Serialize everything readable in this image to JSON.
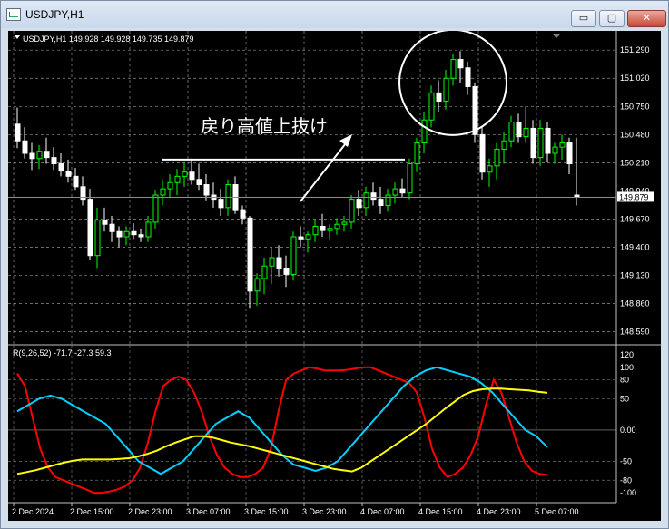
{
  "window": {
    "title": "USDJPY,H1",
    "buttons": {
      "minimize": "▭",
      "maximize": "▢",
      "close": "✕"
    }
  },
  "chart_data": [
    {
      "type": "candlestick",
      "title": "USDJPY,H1  149.928 149.928 149.735 149.879",
      "ylim": [
        148.5,
        151.37
      ],
      "y_ticks": [
        "151.290",
        "151.020",
        "150.750",
        "150.480",
        "150.210",
        "149.940",
        "149.670",
        "149.400",
        "149.130",
        "148.860",
        "148.590"
      ],
      "current_price": "149.879",
      "grid": true,
      "colors": {
        "background": "#000000",
        "bull": "#00ff00",
        "bear": "#ffffff",
        "grid": "#c0c0c0"
      },
      "candles": [
        [
          150.58,
          150.74,
          150.35,
          150.42
        ],
        [
          150.42,
          150.55,
          150.25,
          150.3
        ],
        [
          150.3,
          150.4,
          150.14,
          150.25
        ],
        [
          150.25,
          150.38,
          150.15,
          150.32
        ],
        [
          150.32,
          150.45,
          150.2,
          150.26
        ],
        [
          150.26,
          150.36,
          150.14,
          150.2
        ],
        [
          150.2,
          150.3,
          150.08,
          150.13
        ],
        [
          150.13,
          150.24,
          150.02,
          150.08
        ],
        [
          150.08,
          150.16,
          149.95,
          149.98
        ],
        [
          149.98,
          150.08,
          149.8,
          149.86
        ],
        [
          149.86,
          149.96,
          149.28,
          149.32
        ],
        [
          149.32,
          149.78,
          149.2,
          149.66
        ],
        [
          149.66,
          149.78,
          149.55,
          149.62
        ],
        [
          149.62,
          149.7,
          149.45,
          149.55
        ],
        [
          149.55,
          149.6,
          149.4,
          149.5
        ],
        [
          149.5,
          149.6,
          149.42,
          149.55
        ],
        [
          149.55,
          149.63,
          149.48,
          149.52
        ],
        [
          149.52,
          149.58,
          149.45,
          149.5
        ],
        [
          149.5,
          149.7,
          149.45,
          149.64
        ],
        [
          149.64,
          149.95,
          149.58,
          149.9
        ],
        [
          149.9,
          150.05,
          149.8,
          149.96
        ],
        [
          149.96,
          150.1,
          149.88,
          150.02
        ],
        [
          150.02,
          150.15,
          149.9,
          150.08
        ],
        [
          150.08,
          150.22,
          149.98,
          150.12
        ],
        [
          150.12,
          150.25,
          150.0,
          150.05
        ],
        [
          150.05,
          150.2,
          149.95,
          150.0
        ],
        [
          150.0,
          150.1,
          149.85,
          149.9
        ],
        [
          149.9,
          150.02,
          149.78,
          149.86
        ],
        [
          149.86,
          149.96,
          149.7,
          149.78
        ],
        [
          149.78,
          150.05,
          149.7,
          150.0
        ],
        [
          150.0,
          150.08,
          149.72,
          149.76
        ],
        [
          149.76,
          149.8,
          149.62,
          149.68
        ],
        [
          149.68,
          149.7,
          148.82,
          148.98
        ],
        [
          148.98,
          149.15,
          148.84,
          149.1
        ],
        [
          149.1,
          149.3,
          148.95,
          149.22
        ],
        [
          149.22,
          149.4,
          149.05,
          149.3
        ],
        [
          149.3,
          149.42,
          149.12,
          149.2
        ],
        [
          149.2,
          149.32,
          149.02,
          149.14
        ],
        [
          149.14,
          149.55,
          149.08,
          149.5
        ],
        [
          149.5,
          149.6,
          149.4,
          149.48
        ],
        [
          149.48,
          149.55,
          149.35,
          149.52
        ],
        [
          149.52,
          149.66,
          149.45,
          149.6
        ],
        [
          149.6,
          149.72,
          149.5,
          149.56
        ],
        [
          149.56,
          149.62,
          149.48,
          149.58
        ],
        [
          149.58,
          149.68,
          149.52,
          149.62
        ],
        [
          149.62,
          149.7,
          149.55,
          149.64
        ],
        [
          149.64,
          149.9,
          149.58,
          149.86
        ],
        [
          149.86,
          149.95,
          149.7,
          149.78
        ],
        [
          149.78,
          149.98,
          149.7,
          149.92
        ],
        [
          149.92,
          150.02,
          149.8,
          149.86
        ],
        [
          149.86,
          149.98,
          149.72,
          149.8
        ],
        [
          149.8,
          149.96,
          149.74,
          149.9
        ],
        [
          149.9,
          150.02,
          149.82,
          149.96
        ],
        [
          149.96,
          150.06,
          149.88,
          149.92
        ],
        [
          149.92,
          150.25,
          149.86,
          150.2
        ],
        [
          150.2,
          150.45,
          150.12,
          150.4
        ],
        [
          150.4,
          150.7,
          150.3,
          150.62
        ],
        [
          150.62,
          150.95,
          150.55,
          150.88
        ],
        [
          150.88,
          151.0,
          150.7,
          150.8
        ],
        [
          150.8,
          151.1,
          150.72,
          151.02
        ],
        [
          151.02,
          151.25,
          150.95,
          151.2
        ],
        [
          151.2,
          151.28,
          150.98,
          151.12
        ],
        [
          151.12,
          151.18,
          150.86,
          150.94
        ],
        [
          150.94,
          150.98,
          150.4,
          150.48
        ],
        [
          150.48,
          150.55,
          150.05,
          150.12
        ],
        [
          150.12,
          150.25,
          149.98,
          150.18
        ],
        [
          150.18,
          150.4,
          150.05,
          150.34
        ],
        [
          150.34,
          150.5,
          150.2,
          150.42
        ],
        [
          150.42,
          150.66,
          150.36,
          150.6
        ],
        [
          150.6,
          150.68,
          150.4,
          150.46
        ],
        [
          150.46,
          150.75,
          150.4,
          150.54
        ],
        [
          150.54,
          150.62,
          150.2,
          150.26
        ],
        [
          150.26,
          150.62,
          150.18,
          150.54
        ],
        [
          150.54,
          150.6,
          150.22,
          150.3
        ],
        [
          150.3,
          150.4,
          150.2,
          150.36
        ],
        [
          150.36,
          150.48,
          150.24,
          150.4
        ],
        [
          150.4,
          150.45,
          150.1,
          150.2
        ],
        [
          149.9,
          150.45,
          149.8,
          149.88
        ]
      ],
      "annotation": {
        "text": "戻り高値上抜け",
        "level": 150.24,
        "circle_center": {
          "index": 60,
          "price": 150.98
        }
      }
    },
    {
      "type": "line",
      "title": "R(9,26,52) -71.7 -27.3 59.3",
      "ylim": [
        -110,
        130
      ],
      "y_ticks": [
        "120",
        "100",
        "80",
        "50",
        "0.00",
        "-50",
        "-80",
        "-100"
      ],
      "x_tick_labels": [
        "2 Dec 2024",
        "2 Dec 15:00",
        "2 Dec 23:00",
        "3 Dec 07:00",
        "3 Dec 15:00",
        "3 Dec 23:00",
        "4 Dec 07:00",
        "4 Dec 15:00",
        "4 Dec 23:00",
        "5 Dec 07:00"
      ],
      "x_tick_candle_index": [
        0,
        8,
        16,
        24,
        32,
        40,
        48,
        56,
        64,
        72
      ],
      "reference_line": 0,
      "series": [
        {
          "color": "#ff0000",
          "values": [
            90,
            70,
            20,
            -30,
            -60,
            -75,
            -80,
            -85,
            -90,
            -95,
            -100,
            -100,
            -98,
            -95,
            -90,
            -80,
            -60,
            -20,
            30,
            70,
            80,
            85,
            80,
            60,
            30,
            -10,
            -40,
            -60,
            -70,
            -75,
            -75,
            -70,
            -60,
            -30,
            30,
            80,
            90,
            95,
            100,
            98,
            95,
            95,
            95,
            96,
            98,
            100,
            100,
            95,
            90,
            85,
            80,
            75,
            60,
            20,
            -30,
            -60,
            -75,
            -70,
            -60,
            -40,
            -10,
            40,
            80,
            60,
            20,
            -20,
            -50,
            -65,
            -70,
            -71.7
          ]
        },
        {
          "color": "#00d0ff",
          "values": [
            30,
            40,
            50,
            55,
            50,
            40,
            30,
            20,
            10,
            -10,
            -30,
            -50,
            -60,
            -70,
            -60,
            -50,
            -30,
            -10,
            10,
            20,
            30,
            20,
            0,
            -20,
            -40,
            -55,
            -60,
            -65,
            -60,
            -50,
            -30,
            -10,
            10,
            30,
            50,
            70,
            85,
            95,
            100,
            95,
            90,
            85,
            75,
            60,
            40,
            20,
            0,
            -10,
            -27.3
          ]
        },
        {
          "color": "#ffff00",
          "values": [
            -70,
            -67,
            -64,
            -60,
            -56,
            -52,
            -49,
            -47,
            -47,
            -47,
            -47,
            -46,
            -45,
            -42,
            -38,
            -33,
            -26,
            -20,
            -15,
            -10,
            -10,
            -12,
            -16,
            -20,
            -23,
            -26,
            -30,
            -34,
            -38,
            -42,
            -46,
            -50,
            -54,
            -58,
            -62,
            -64,
            -66,
            -60,
            -50,
            -40,
            -30,
            -20,
            -10,
            0,
            10,
            22,
            34,
            45,
            56,
            62,
            65,
            66,
            66,
            65,
            64,
            63,
            61,
            59.3
          ]
        }
      ]
    }
  ]
}
